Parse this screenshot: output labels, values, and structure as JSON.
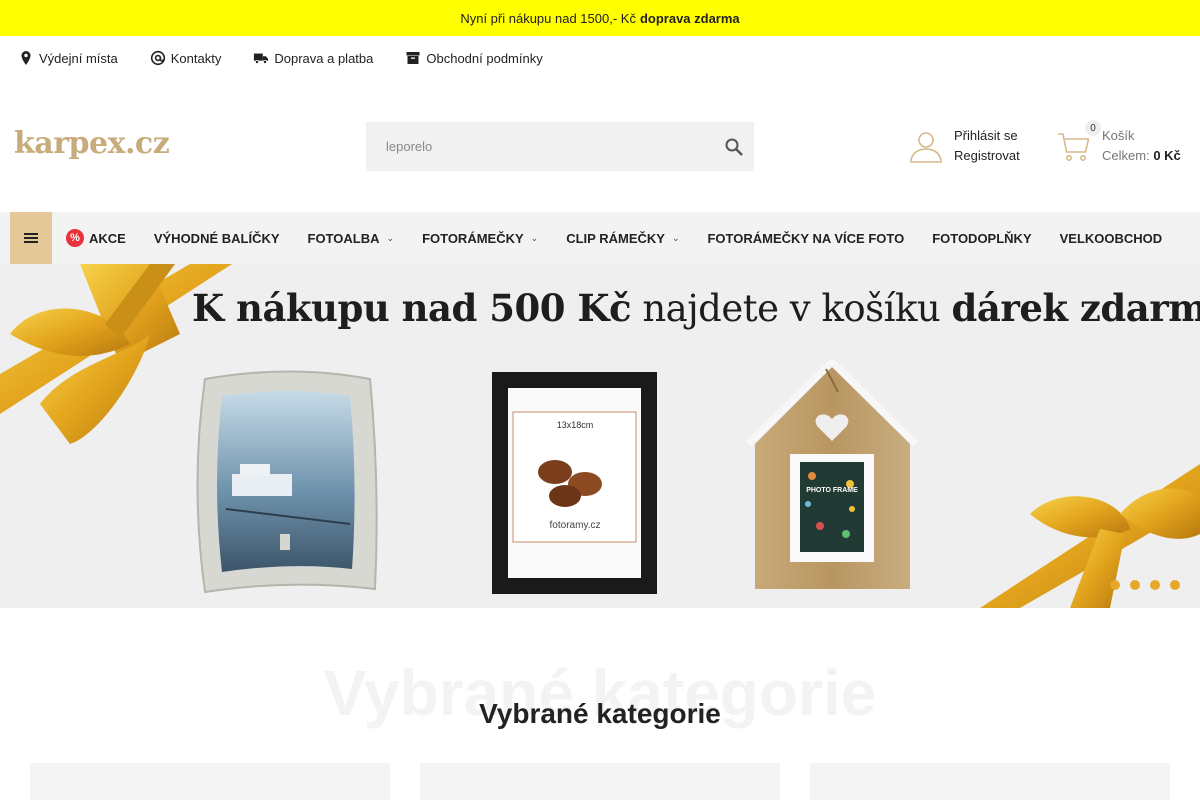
{
  "promo": {
    "text": "Nyní při nákupu nad 1500,- Kč",
    "bold": "doprava zdarma"
  },
  "util_links": [
    {
      "label": "Výdejní místa",
      "icon": "map-pin-icon"
    },
    {
      "label": "Kontakty",
      "icon": "at-icon"
    },
    {
      "label": "Doprava a platba",
      "icon": "truck-icon"
    },
    {
      "label": "Obchodní podmínky",
      "icon": "archive-icon"
    }
  ],
  "header": {
    "logo": "karpex.cz",
    "search_placeholder": "leporelo",
    "account": {
      "login": "Přihlásit se",
      "register": "Registrovat"
    },
    "cart": {
      "count": "0",
      "label": "Košík",
      "total_label": "Celkem:",
      "total_value": "0 Kč"
    }
  },
  "nav": {
    "items": [
      {
        "label": "AKCE",
        "badge": "%"
      },
      {
        "label": "VÝHODNÉ BALÍČKY"
      },
      {
        "label": "FOTOALBA",
        "dropdown": true
      },
      {
        "label": "FOTORÁMEČKY",
        "dropdown": true
      },
      {
        "label": "CLIP RÁMEČKY",
        "dropdown": true
      },
      {
        "label": "FOTORÁMEČKY NA VÍCE FOTO"
      },
      {
        "label": "FOTODOPLŇKY"
      },
      {
        "label": "VELKOOBCHOD"
      }
    ]
  },
  "banner": {
    "title_bold_1": "K nákupu nad 500 Kč",
    "title_regular": "najdete v košíku",
    "title_bold_2": "dárek zdarma",
    "frame_label_1": "13x18cm",
    "frame_label_2": "fotoramy.cz",
    "frame_label_3": "PHOTO FRAME",
    "slides": 4
  },
  "categories": {
    "ghost_title": "Vybrané kategorie",
    "title": "Vybrané kategorie"
  }
}
